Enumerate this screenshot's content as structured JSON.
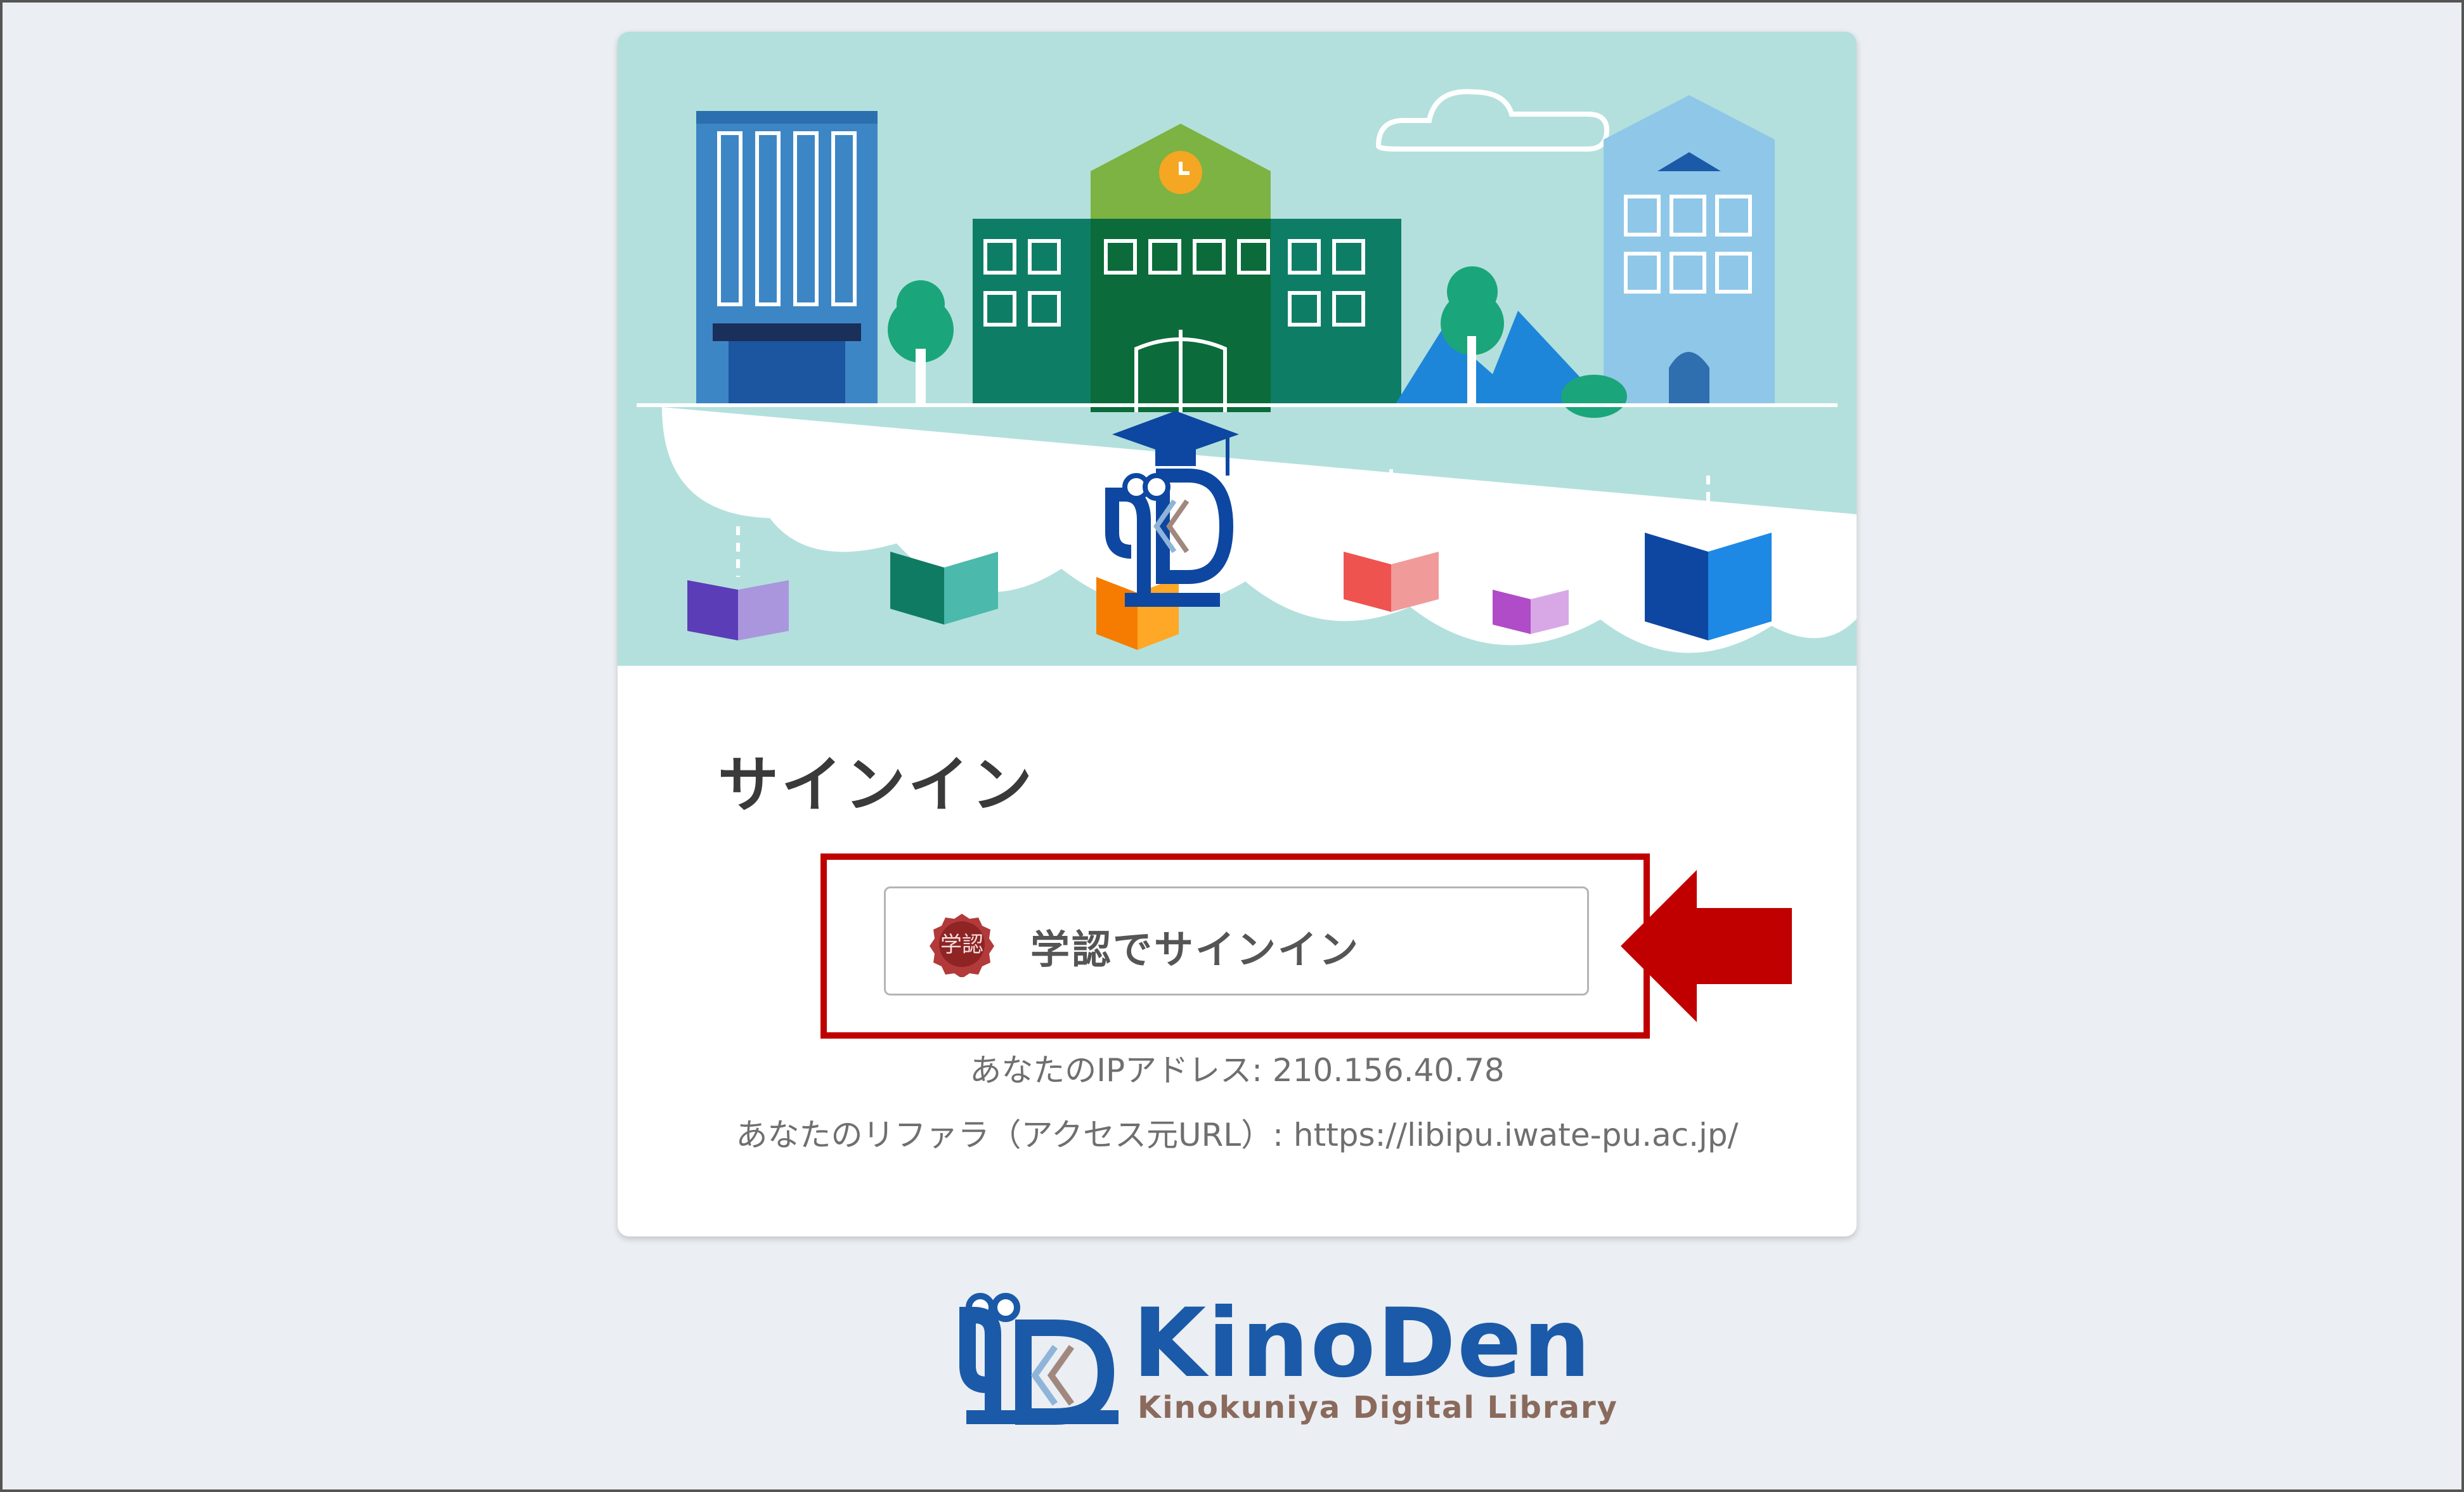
{
  "signin": {
    "title": "サインイン",
    "button_label": "学認でサインイン",
    "button_icon": "gakunin-seal-icon",
    "icon_text": "学認"
  },
  "info": {
    "ip_line": "あなたのIPアドレス: 210.156.40.78",
    "referrer_line": "あなたのリファラ（アクセス元URL）: https://libipu.iwate-pu.ac.jp/"
  },
  "brand": {
    "name": "KinoDen",
    "subtitle": "Kinokuniya Digital Library"
  },
  "colors": {
    "hero_background": "#b3e0dd",
    "highlight": "#c00000",
    "brand_blue": "#1b5aa8",
    "page_background": "#ebeef2"
  }
}
